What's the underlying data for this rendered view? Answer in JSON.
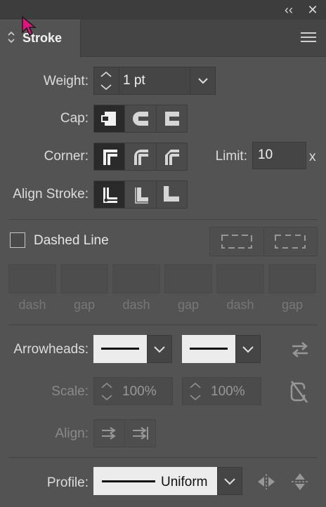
{
  "header": {
    "collapse_glyph": "‹‹",
    "close_glyph": "✕",
    "tab_title": "Stroke",
    "menu_icon": "hamburger-icon"
  },
  "weight": {
    "label": "Weight:",
    "value": "1 pt"
  },
  "cap": {
    "label": "Cap:",
    "options": [
      "butt-cap-icon",
      "round-cap-icon",
      "projecting-cap-icon"
    ],
    "selected": 0
  },
  "corner": {
    "label": "Corner:",
    "options": [
      "miter-join-icon",
      "round-join-icon",
      "bevel-join-icon"
    ],
    "selected": 0,
    "limit_label": "Limit:",
    "limit_value": "10",
    "limit_unit": "x"
  },
  "align_stroke": {
    "label": "Align Stroke:",
    "options": [
      "align-center-icon",
      "align-inside-icon",
      "align-outside-icon"
    ],
    "selected": 0
  },
  "dashed": {
    "label": "Dashed Line",
    "checked": false,
    "labels": [
      "dash",
      "gap",
      "dash",
      "gap",
      "dash",
      "gap"
    ]
  },
  "arrowheads": {
    "label": "Arrowheads:"
  },
  "scale": {
    "label": "Scale:",
    "start": "100%",
    "end": "100%"
  },
  "align": {
    "label": "Align:"
  },
  "profile": {
    "label": "Profile:",
    "value": "Uniform"
  },
  "colors": {
    "panel": "#535353",
    "selected": "#2a2a2a",
    "cursor": "#e0147a"
  }
}
